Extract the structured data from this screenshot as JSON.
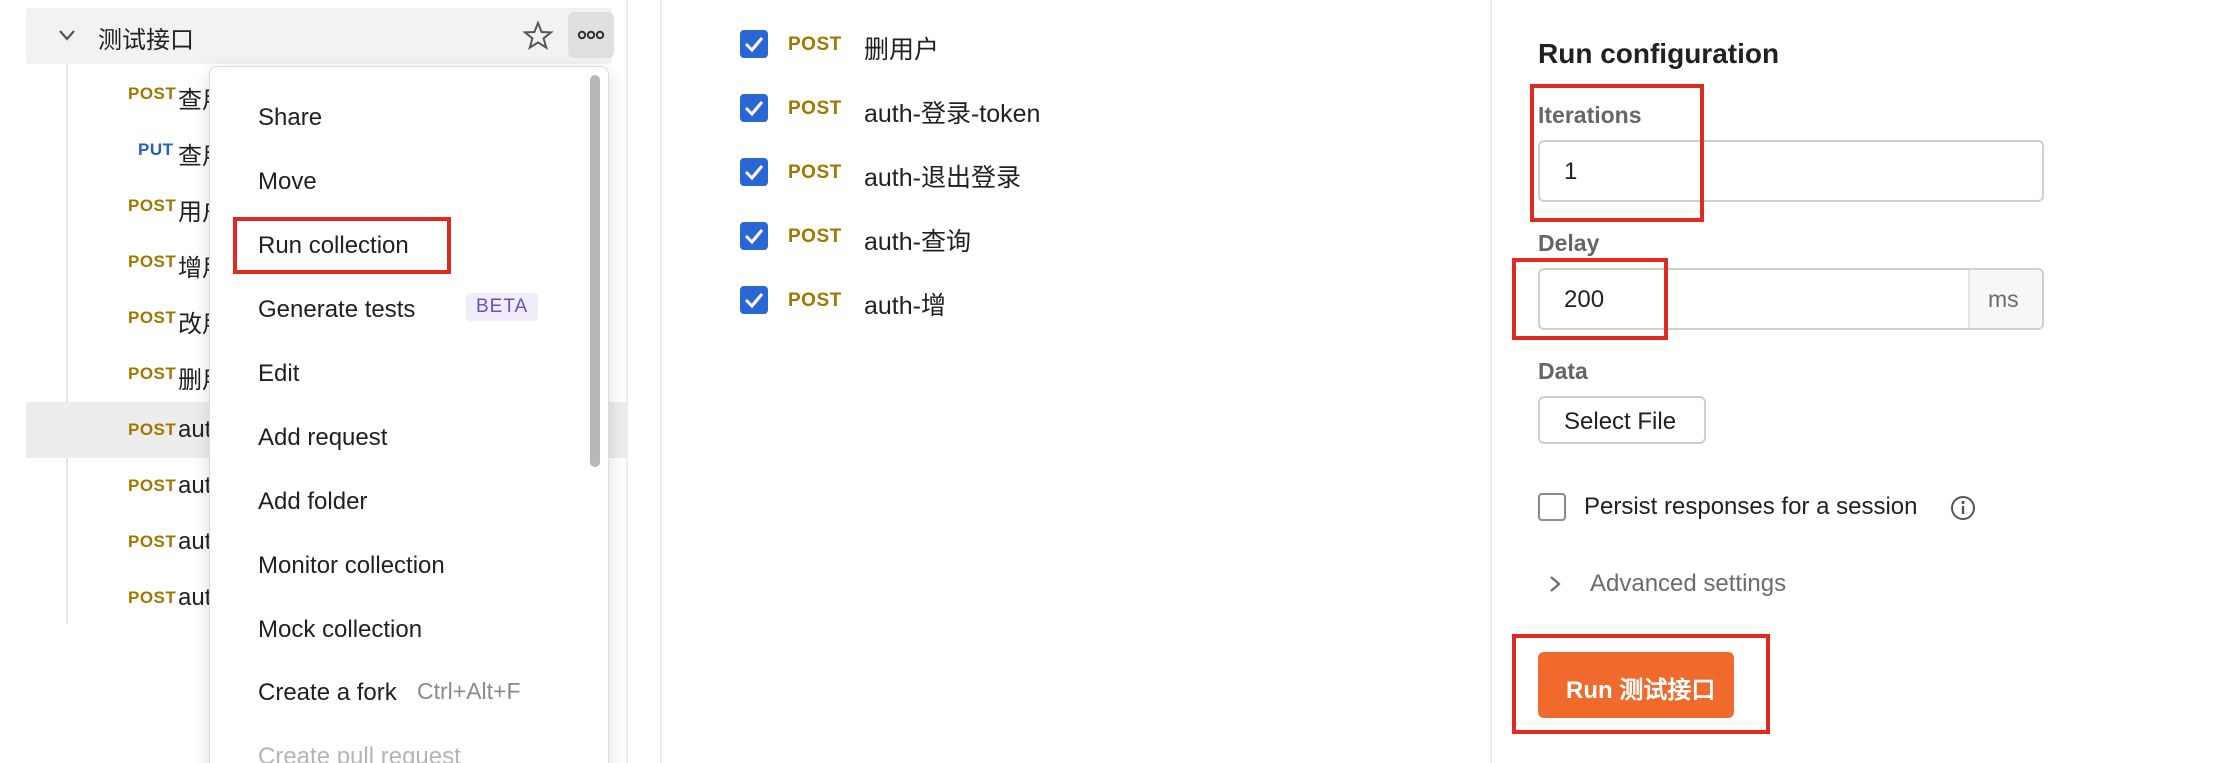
{
  "sidebar": {
    "collection_name": "测试接口",
    "requests": [
      {
        "method": "POST",
        "name": "查用户"
      },
      {
        "method": "PUT",
        "name": "查用户"
      },
      {
        "method": "POST",
        "name": "用户"
      },
      {
        "method": "POST",
        "name": "增用户"
      },
      {
        "method": "POST",
        "name": "改用户"
      },
      {
        "method": "POST",
        "name": "删用户"
      },
      {
        "method": "POST",
        "name": "auth"
      },
      {
        "method": "POST",
        "name": "auth"
      },
      {
        "method": "POST",
        "name": "auth"
      },
      {
        "method": "POST",
        "name": "auth"
      }
    ]
  },
  "context_menu": {
    "items": [
      "Share",
      "Move",
      "Run collection",
      "Generate tests",
      "Edit",
      "Add request",
      "Add folder",
      "Monitor collection",
      "Mock collection",
      "Create a fork",
      "Create pull request"
    ],
    "beta_badge": "BETA",
    "fork_shortcut": "Ctrl+Alt+F"
  },
  "run_order": [
    {
      "method": "POST",
      "name": "删用户",
      "checked": true
    },
    {
      "method": "POST",
      "name": "auth-登录-token",
      "checked": true
    },
    {
      "method": "POST",
      "name": "auth-退出登录",
      "checked": true
    },
    {
      "method": "POST",
      "name": "auth-查询",
      "checked": true
    },
    {
      "method": "POST",
      "name": "auth-增",
      "checked": true
    }
  ],
  "run_config": {
    "title": "Run configuration",
    "iterations_label": "Iterations",
    "iterations_value": "1",
    "delay_label": "Delay",
    "delay_value": "200",
    "delay_unit": "ms",
    "data_label": "Data",
    "select_file_label": "Select File",
    "persist_label": "Persist responses for a session",
    "advanced_label": "Advanced settings",
    "run_button_label": "Run 测试接口"
  },
  "colors": {
    "post": "#a07800",
    "put": "#1f5fd0",
    "checkbox": "#2a66d6",
    "run_button": "#f06a2d",
    "highlight": "#e02a1f"
  },
  "icons": [
    "chevron-down-icon",
    "star-icon",
    "more-icon",
    "checkmark-icon",
    "info-icon",
    "chevron-right-icon"
  ]
}
